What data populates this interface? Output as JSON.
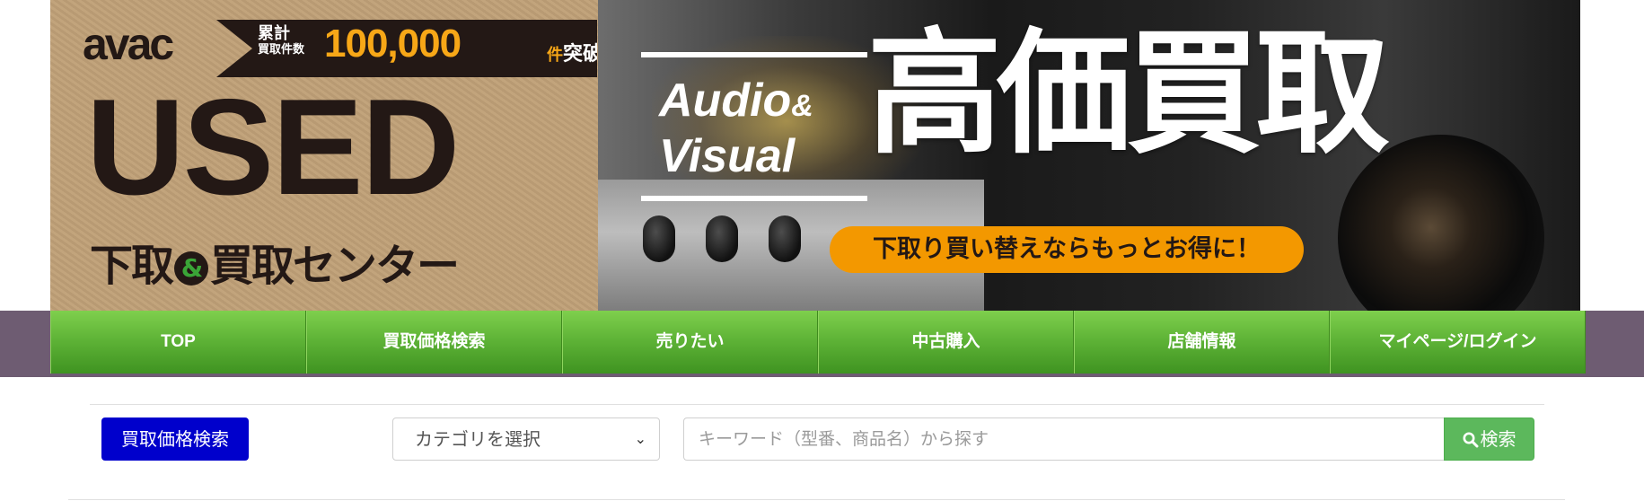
{
  "banner": {
    "logo_text": "avac",
    "ribbon_line1": "累計",
    "ribbon_line2": "買取件数",
    "ribbon_count": "100,000",
    "ribbon_unit": "件",
    "ribbon_tail": "突破！",
    "used_text": "USED",
    "center_left": "下取",
    "center_amp": "&",
    "center_right": "買取センター",
    "audio_text": "Audio",
    "audio_amp": "&",
    "visual_text": "Visual",
    "big_title": "高価買取",
    "pill_text": "下取り買い替えならもっとお得に！",
    "colors": {
      "orange": "#f39800",
      "green": "#3aa537",
      "dark": "#231815"
    }
  },
  "nav": {
    "items": [
      {
        "label": "TOP"
      },
      {
        "label": "買取価格検索"
      },
      {
        "label": "売りたい"
      },
      {
        "label": "中古購入"
      },
      {
        "label": "店舗情報"
      },
      {
        "label": "マイページ/ログイン"
      }
    ],
    "colors": {
      "green": "#5fb437",
      "band": "#6e5c72"
    }
  },
  "search": {
    "label": "買取価格検索",
    "category_selected": "カテゴリを選択",
    "keyword_placeholder": "キーワード（型番、商品名）から探す",
    "button_label": "検索",
    "button_icon": "search-icon",
    "colors": {
      "label_bg": "#0000cc",
      "button_bg": "#5cb85c"
    }
  }
}
